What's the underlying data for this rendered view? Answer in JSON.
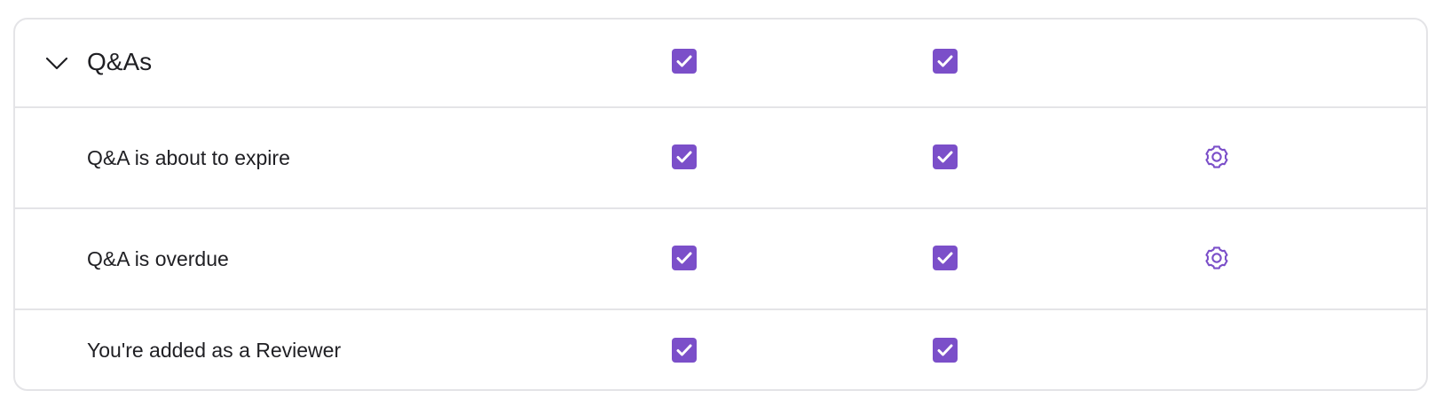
{
  "section": {
    "title": "Q&As",
    "expanded": true,
    "header_checks": [
      true,
      true
    ],
    "icons": {
      "toggle": "chevron-down-icon",
      "check": "check-icon",
      "settings": "gear-icon"
    }
  },
  "rows": [
    {
      "label": "Q&A is about to expire",
      "checks": [
        true,
        true
      ],
      "has_settings": true
    },
    {
      "label": "Q&A is overdue",
      "checks": [
        true,
        true
      ],
      "has_settings": true
    },
    {
      "label": "You're added as a Reviewer",
      "checks": [
        true,
        true
      ],
      "has_settings": false
    }
  ],
  "colors": {
    "accent": "#7b4fc9",
    "text": "#1f1f23",
    "border": "#e4e4e7"
  }
}
